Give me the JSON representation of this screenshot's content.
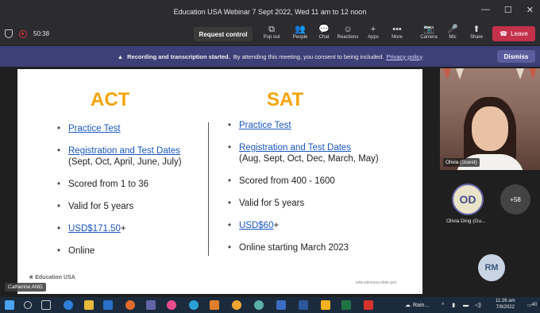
{
  "window": {
    "title": "Education USA Webinar 7 Sept 2022, Wed 11 am to 12 noon",
    "minimize": "—",
    "maximize": "☐",
    "close": "✕"
  },
  "meeting": {
    "timer": "50:38",
    "request_control": "Request control"
  },
  "toolbar": [
    {
      "label": "Pop out",
      "icon": "popout-icon",
      "glyph": "⧉"
    },
    {
      "label": "People",
      "icon": "people-icon",
      "glyph": "👥"
    },
    {
      "label": "Chat",
      "icon": "chat-icon",
      "glyph": "💬"
    },
    {
      "label": "Reactions",
      "icon": "reactions-icon",
      "glyph": "☺"
    },
    {
      "label": "Apps",
      "icon": "apps-icon",
      "glyph": "+"
    },
    {
      "label": "More",
      "icon": "more-icon",
      "glyph": "•••"
    },
    {
      "label": "Camera",
      "icon": "camera-off-icon",
      "glyph": "📷"
    },
    {
      "label": "Mic",
      "icon": "mic-off-icon",
      "glyph": "🎤"
    },
    {
      "label": "Share",
      "icon": "share-icon",
      "glyph": "⬆"
    }
  ],
  "leave_label": "Leave",
  "banner": {
    "bold": "Recording and transcription started.",
    "text": "By attending this meeting, you consent to being included.",
    "link": "Privacy policy",
    "dismiss": "Dismiss"
  },
  "slide": {
    "act": {
      "heading": "ACT",
      "items": [
        {
          "link": "Practice Test",
          "rest": ""
        },
        {
          "link": "Registration and Test Dates",
          "rest": "(Sept, Oct, April, June, July)"
        },
        {
          "link": "",
          "rest": "Scored from 1 to 36"
        },
        {
          "link": "",
          "rest": "Valid for 5 years"
        },
        {
          "link": "USD$171.50",
          "rest": "+"
        },
        {
          "link": "",
          "rest": "Online"
        }
      ]
    },
    "sat": {
      "heading": "SAT",
      "items": [
        {
          "link": "Practice Test",
          "rest": ""
        },
        {
          "link": "Registration and Test Dates",
          "rest": "(Aug, Sept, Oct, Dec, March, May)"
        },
        {
          "link": "",
          "rest": "Scored from 400 - 1600"
        },
        {
          "link": "",
          "rest": "Valid for 5 years"
        },
        {
          "link": "USD$60",
          "rest": "+"
        },
        {
          "link": "",
          "rest": "Online starting March 2023"
        }
      ]
    },
    "footer_url": "educationusa.state.gov",
    "logo_text": "Education USA"
  },
  "presenter_chip": "Catherine ANG",
  "participants": {
    "video_name": "Olivia (Guest)",
    "od_initials": "OD",
    "od_name": "Olivia Ding (Gu...",
    "more_count": "+58",
    "rm_initials": "RM"
  },
  "taskbar": {
    "weather": "Rain...",
    "time": "11:26 am",
    "date": "7/9/2022",
    "notifications": "40"
  }
}
